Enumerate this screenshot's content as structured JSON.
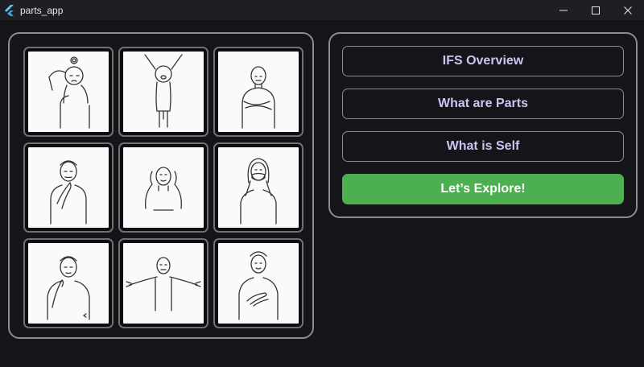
{
  "window": {
    "title": "parts_app",
    "icons": [
      "flutter-logo-icon",
      "minimize-icon",
      "maximize-icon",
      "close-icon"
    ]
  },
  "grid": {
    "tiles": [
      {
        "name": "tile-confused-person",
        "illustration": "person scratching head, confused"
      },
      {
        "name": "tile-excited-child",
        "illustration": "child with arms raised, excited"
      },
      {
        "name": "tile-arms-crossed",
        "illustration": "person with arms crossed, defensive"
      },
      {
        "name": "tile-thinking-person",
        "illustration": "person with hand on chin, thinking"
      },
      {
        "name": "tile-covering-ears",
        "illustration": "person covering ears, overwhelmed"
      },
      {
        "name": "tile-covering-mouth",
        "illustration": "woman covering mouth, surprised"
      },
      {
        "name": "tile-pondering-person",
        "illustration": "person touching cheek, pondering"
      },
      {
        "name": "tile-arms-open",
        "illustration": "person with arms open wide"
      },
      {
        "name": "tile-hand-on-heart",
        "illustration": "person with hands on chest, calm"
      }
    ]
  },
  "menu": {
    "ifs_overview": "IFS Overview",
    "what_are_parts": "What are Parts",
    "what_is_self": "What is Self",
    "explore": "Let’s Explore!"
  },
  "colors": {
    "background": "#141419",
    "titlebar": "#1f1f23",
    "panel_border": "#8a8a8f",
    "button_text": "#c9c6f2",
    "accent_green": "#4caf50"
  }
}
